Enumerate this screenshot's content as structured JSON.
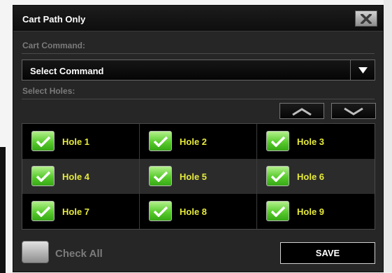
{
  "dialog": {
    "title": "Cart Path Only",
    "close_icon": "close-x-icon"
  },
  "command": {
    "section_label": "Cart Command:",
    "selected": "Select Command",
    "dropdown_icon": "caret-down-icon"
  },
  "holes": {
    "section_label": "Select Holes:",
    "scroll_up_icon": "chevron-up-icon",
    "scroll_down_icon": "chevron-down-icon",
    "rows": [
      [
        {
          "label": "Hole 1",
          "checked": true
        },
        {
          "label": "Hole 2",
          "checked": true
        },
        {
          "label": "Hole 3",
          "checked": true
        }
      ],
      [
        {
          "label": "Hole 4",
          "checked": true
        },
        {
          "label": "Hole 5",
          "checked": true
        },
        {
          "label": "Hole 6",
          "checked": true
        }
      ],
      [
        {
          "label": "Hole 7",
          "checked": true
        },
        {
          "label": "Hole 8",
          "checked": true
        },
        {
          "label": "Hole 9",
          "checked": true
        }
      ]
    ]
  },
  "footer": {
    "check_all_label": "Check All",
    "check_all_checked": false,
    "save_label": "SAVE"
  },
  "colors": {
    "hole_label": "#e6ea3a",
    "checkbox_green": "#59cc2e",
    "dialog_bg": "#262626"
  }
}
